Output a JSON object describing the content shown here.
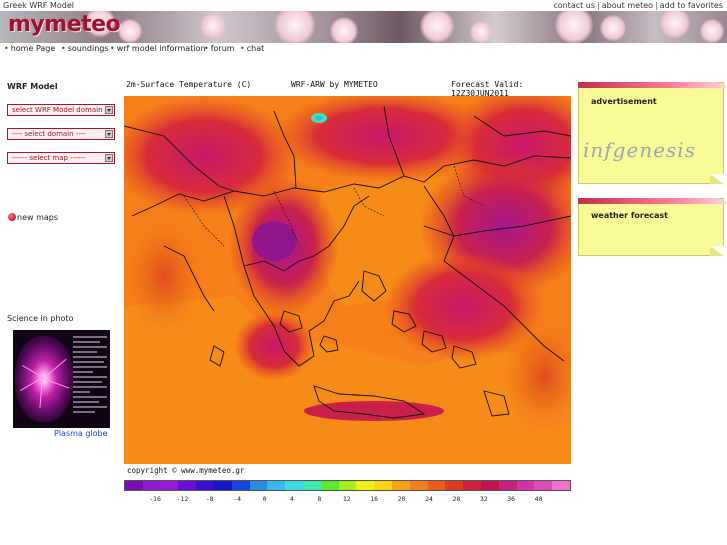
{
  "top": {
    "site_name": "Greek WRF Model",
    "links": [
      "contact us",
      "about meteo",
      "add to favorites"
    ]
  },
  "banner": {
    "logo": "mymeteo"
  },
  "nav": {
    "items": [
      "home Page",
      "soundings",
      "wrf model information",
      "forum",
      "chat"
    ]
  },
  "sidebar": {
    "title": "WRF Model",
    "selects": [
      {
        "label": "select WRF Model domain"
      },
      {
        "label": "---- select domain ----"
      },
      {
        "label": "------ select map ------"
      }
    ],
    "new_maps": "new maps",
    "science_title": "Science in photo",
    "science_caption": "Plasma globe"
  },
  "map": {
    "title_left": "2m-Surface Temperature (C)",
    "title_mid": "WRF-ARW by MYMETEO",
    "title_right": "Forecast Valid: 12Z30JUN2011",
    "footer": "copyright © www.mymeteo.gr",
    "colorbar_colors": [
      "#7b0fb5",
      "#8e1ed0",
      "#9a1ad8",
      "#6b0fd6",
      "#3a0fd0",
      "#1414c8",
      "#1546d8",
      "#2a8ae4",
      "#36b8ee",
      "#3fd8e6",
      "#3fe8a8",
      "#5aea2a",
      "#a6ee1c",
      "#eef014",
      "#f8d514",
      "#f8a416",
      "#f5801a",
      "#ee5a1c",
      "#e23a22",
      "#d0203a",
      "#c4104e",
      "#c81f80",
      "#d233a8",
      "#e04ac0",
      "#f070d4"
    ],
    "colorbar_labels": [
      "-16",
      "-12",
      "-8",
      "-4",
      "0",
      "4",
      "8",
      "12",
      "16",
      "20",
      "24",
      "28",
      "32",
      "36",
      "40"
    ]
  },
  "right": {
    "ad_label": "advertisement",
    "ad_brand": "infgenesis",
    "weather_label": "weather forecast"
  }
}
